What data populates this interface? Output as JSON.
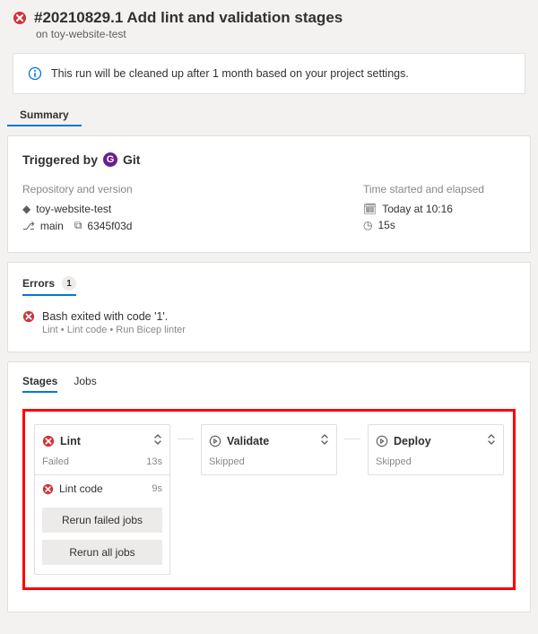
{
  "header": {
    "title": "#20210829.1 Add lint and validation stages",
    "subtitle_prefix": "on",
    "subtitle_repo": "toy-website-test"
  },
  "notice": {
    "text": "This run will be cleaned up after 1 month based on your project settings."
  },
  "summary_header": "Summary",
  "summary": {
    "triggered_by_label": "Triggered by",
    "git_avatar_letter": "G",
    "git_label": "Git",
    "repo_col_title": "Repository and version",
    "repo_name": "toy-website-test",
    "branch": "main",
    "commit": "6345f03d",
    "time_col_title": "Time started and elapsed",
    "started": "Today at 10:16",
    "elapsed": "15s"
  },
  "errors": {
    "header": "Errors",
    "count": "1",
    "items": [
      {
        "message": "Bash exited with code '1'.",
        "path": "Lint • Lint code • Run Bicep linter"
      }
    ]
  },
  "stages_section": {
    "tab_stages": "Stages",
    "tab_jobs": "Jobs",
    "stages": [
      {
        "name": "Lint",
        "status": "Failed",
        "duration": "13s",
        "icon": "fail",
        "job": {
          "name": "Lint code",
          "duration": "9s",
          "icon": "fail"
        },
        "actions": {
          "rerun_failed": "Rerun failed jobs",
          "rerun_all": "Rerun all jobs"
        }
      },
      {
        "name": "Validate",
        "status": "Skipped",
        "icon": "skipped"
      },
      {
        "name": "Deploy",
        "status": "Skipped",
        "icon": "skipped"
      }
    ]
  }
}
